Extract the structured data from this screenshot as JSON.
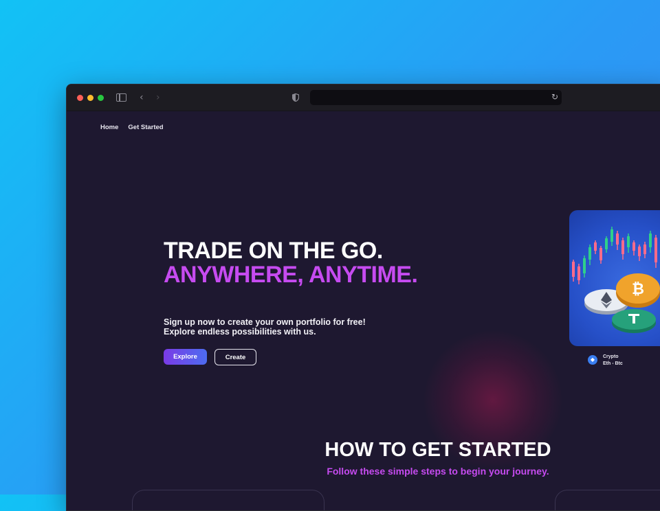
{
  "nav": {
    "items": [
      "Home",
      "Get Started"
    ]
  },
  "hero": {
    "title_line1": "TRADE ON THE GO.",
    "title_line2": "ANYWHERE, ANYTIME.",
    "subtitle_line1": "Sign up now to create your own portfolio for free!",
    "subtitle_line2": "Explore endless possibilities with us.",
    "explore_label": "Explore",
    "create_label": "Create"
  },
  "card": {
    "caption_title": "Crypto",
    "caption_sub": "Eth - Btc",
    "icons": [
      "ethereum-icon",
      "bitcoin-coin",
      "ethereum-coin",
      "tether-coin",
      "candlestick-chart"
    ]
  },
  "section": {
    "title": "HOW TO GET STARTED",
    "subtitle": "Follow these simple steps to begin your journey."
  },
  "colors": {
    "accent": "#c64bf0",
    "background": "#1e1830",
    "button_gradient_start": "#7a3be6",
    "button_gradient_end": "#4d6cf0"
  }
}
